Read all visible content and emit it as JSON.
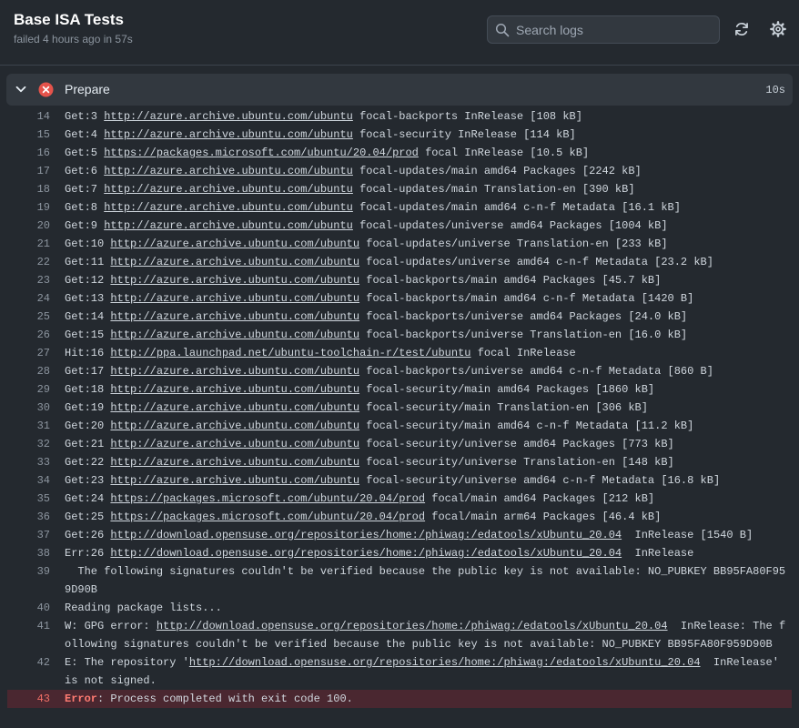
{
  "header": {
    "title": "Base ISA Tests",
    "subtitle": "failed 4 hours ago in 57s",
    "search_placeholder": "Search logs"
  },
  "step": {
    "name": "Prepare",
    "duration": "10s",
    "status": "failed"
  },
  "colors": {
    "background": "#24292f",
    "step_bg": "#32383f",
    "fail_red": "#e5534b",
    "error_row_bg": "#4a2730"
  },
  "icons": [
    "search-icon",
    "refresh-icon",
    "gear-icon",
    "chevron-down-icon",
    "failure-icon"
  ],
  "log_lines": [
    {
      "num": "14",
      "pre": "Get:3 ",
      "url": "http://azure.archive.ubuntu.com/ubuntu",
      "post": " focal-backports InRelease [108 kB]"
    },
    {
      "num": "15",
      "pre": "Get:4 ",
      "url": "http://azure.archive.ubuntu.com/ubuntu",
      "post": " focal-security InRelease [114 kB]"
    },
    {
      "num": "16",
      "pre": "Get:5 ",
      "url": "https://packages.microsoft.com/ubuntu/20.04/prod",
      "post": " focal InRelease [10.5 kB]"
    },
    {
      "num": "17",
      "pre": "Get:6 ",
      "url": "http://azure.archive.ubuntu.com/ubuntu",
      "post": " focal-updates/main amd64 Packages [2242 kB]"
    },
    {
      "num": "18",
      "pre": "Get:7 ",
      "url": "http://azure.archive.ubuntu.com/ubuntu",
      "post": " focal-updates/main Translation-en [390 kB]"
    },
    {
      "num": "19",
      "pre": "Get:8 ",
      "url": "http://azure.archive.ubuntu.com/ubuntu",
      "post": " focal-updates/main amd64 c-n-f Metadata [16.1 kB]"
    },
    {
      "num": "20",
      "pre": "Get:9 ",
      "url": "http://azure.archive.ubuntu.com/ubuntu",
      "post": " focal-updates/universe amd64 Packages [1004 kB]"
    },
    {
      "num": "21",
      "pre": "Get:10 ",
      "url": "http://azure.archive.ubuntu.com/ubuntu",
      "post": " focal-updates/universe Translation-en [233 kB]"
    },
    {
      "num": "22",
      "pre": "Get:11 ",
      "url": "http://azure.archive.ubuntu.com/ubuntu",
      "post": " focal-updates/universe amd64 c-n-f Metadata [23.2 kB]"
    },
    {
      "num": "23",
      "pre": "Get:12 ",
      "url": "http://azure.archive.ubuntu.com/ubuntu",
      "post": " focal-backports/main amd64 Packages [45.7 kB]"
    },
    {
      "num": "24",
      "pre": "Get:13 ",
      "url": "http://azure.archive.ubuntu.com/ubuntu",
      "post": " focal-backports/main amd64 c-n-f Metadata [1420 B]"
    },
    {
      "num": "25",
      "pre": "Get:14 ",
      "url": "http://azure.archive.ubuntu.com/ubuntu",
      "post": " focal-backports/universe amd64 Packages [24.0 kB]"
    },
    {
      "num": "26",
      "pre": "Get:15 ",
      "url": "http://azure.archive.ubuntu.com/ubuntu",
      "post": " focal-backports/universe Translation-en [16.0 kB]"
    },
    {
      "num": "27",
      "pre": "Hit:16 ",
      "url": "http://ppa.launchpad.net/ubuntu-toolchain-r/test/ubuntu",
      "post": " focal InRelease"
    },
    {
      "num": "28",
      "pre": "Get:17 ",
      "url": "http://azure.archive.ubuntu.com/ubuntu",
      "post": " focal-backports/universe amd64 c-n-f Metadata [860 B]"
    },
    {
      "num": "29",
      "pre": "Get:18 ",
      "url": "http://azure.archive.ubuntu.com/ubuntu",
      "post": " focal-security/main amd64 Packages [1860 kB]"
    },
    {
      "num": "30",
      "pre": "Get:19 ",
      "url": "http://azure.archive.ubuntu.com/ubuntu",
      "post": " focal-security/main Translation-en [306 kB]"
    },
    {
      "num": "31",
      "pre": "Get:20 ",
      "url": "http://azure.archive.ubuntu.com/ubuntu",
      "post": " focal-security/main amd64 c-n-f Metadata [11.2 kB]"
    },
    {
      "num": "32",
      "pre": "Get:21 ",
      "url": "http://azure.archive.ubuntu.com/ubuntu",
      "post": " focal-security/universe amd64 Packages [773 kB]"
    },
    {
      "num": "33",
      "pre": "Get:22 ",
      "url": "http://azure.archive.ubuntu.com/ubuntu",
      "post": " focal-security/universe Translation-en [148 kB]"
    },
    {
      "num": "34",
      "pre": "Get:23 ",
      "url": "http://azure.archive.ubuntu.com/ubuntu",
      "post": " focal-security/universe amd64 c-n-f Metadata [16.8 kB]"
    },
    {
      "num": "35",
      "pre": "Get:24 ",
      "url": "https://packages.microsoft.com/ubuntu/20.04/prod",
      "post": " focal/main amd64 Packages [212 kB]"
    },
    {
      "num": "36",
      "pre": "Get:25 ",
      "url": "https://packages.microsoft.com/ubuntu/20.04/prod",
      "post": " focal/main arm64 Packages [46.4 kB]"
    },
    {
      "num": "37",
      "pre": "Get:26 ",
      "url": "http://download.opensuse.org/repositories/home:/phiwag:/edatools/xUbuntu_20.04",
      "post": "  InRelease [1540 B]"
    },
    {
      "num": "38",
      "pre": "Err:26 ",
      "url": "http://download.opensuse.org/repositories/home:/phiwag:/edatools/xUbuntu_20.04",
      "post": "  InRelease"
    },
    {
      "num": "39",
      "pre": "  The following signatures couldn't be verified because the public key is not available: NO_PUBKEY BB95FA80F959D90B",
      "url": "",
      "post": ""
    },
    {
      "num": "40",
      "pre": "Reading package lists...",
      "url": "",
      "post": ""
    },
    {
      "num": "41",
      "pre": "W: GPG error: ",
      "url": "http://download.opensuse.org/repositories/home:/phiwag:/edatools/xUbuntu_20.04",
      "post": "  InRelease: The following signatures couldn't be verified because the public key is not available: NO_PUBKEY BB95FA80F959D90B"
    },
    {
      "num": "42",
      "pre": "E: The repository '",
      "url": "http://download.opensuse.org/repositories/home:/phiwag:/edatools/xUbuntu_20.04",
      "post": "  InRelease' is not signed."
    }
  ],
  "error_line": {
    "num": "43",
    "keyword": "Error",
    "message": ": Process completed with exit code 100."
  }
}
